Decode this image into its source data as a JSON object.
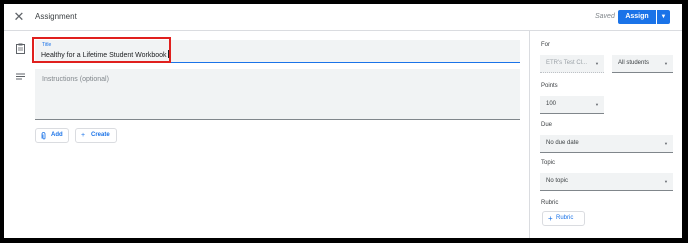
{
  "header": {
    "title": "Assignment",
    "saved_status": "Saved",
    "assign_label": "Assign"
  },
  "form": {
    "title_label": "Title",
    "title_value": "Healthy for a Lifetime Student Workbook",
    "instructions_placeholder": "Instructions (optional)",
    "add_label": "Add",
    "create_label": "Create"
  },
  "sidebar": {
    "for_label": "For",
    "class_value": "ETR's Test Cl...",
    "students_value": "All students",
    "points_label": "Points",
    "points_value": "100",
    "due_label": "Due",
    "due_value": "No due date",
    "topic_label": "Topic",
    "topic_value": "No topic",
    "rubric_label": "Rubric",
    "rubric_button": "Rubric"
  },
  "icons": {
    "close": "close-icon",
    "assignment": "assignment-icon",
    "notes": "notes-icon",
    "attach": "paperclip-icon",
    "plus": "plus-icon",
    "dropdown": "chevron-down-icon"
  },
  "colors": {
    "accent": "#1a73e8",
    "highlight": "#e0201e"
  }
}
